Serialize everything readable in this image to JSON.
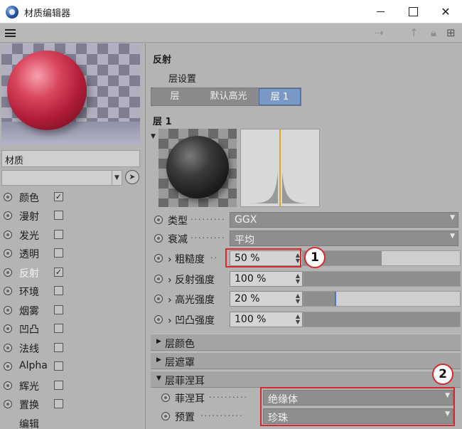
{
  "window": {
    "title": "材质编辑器"
  },
  "sidebar": {
    "material_name": "材质",
    "channels": [
      {
        "label": "颜色",
        "checkbox": true,
        "checked": true,
        "active": false
      },
      {
        "label": "漫射",
        "checkbox": true,
        "checked": false,
        "active": false
      },
      {
        "label": "发光",
        "checkbox": true,
        "checked": false,
        "active": false
      },
      {
        "label": "透明",
        "checkbox": true,
        "checked": false,
        "active": false
      },
      {
        "label": "反射",
        "checkbox": true,
        "checked": true,
        "active": true
      },
      {
        "label": "环境",
        "checkbox": true,
        "checked": false,
        "active": false
      },
      {
        "label": "烟雾",
        "checkbox": true,
        "checked": false,
        "active": false
      },
      {
        "label": "凹凸",
        "checkbox": true,
        "checked": false,
        "active": false
      },
      {
        "label": "法线",
        "checkbox": true,
        "checked": false,
        "active": false
      },
      {
        "label": "Alpha",
        "checkbox": true,
        "checked": false,
        "active": false
      },
      {
        "label": "辉光",
        "checkbox": true,
        "checked": false,
        "active": false
      },
      {
        "label": "置换",
        "checkbox": true,
        "checked": false,
        "active": false
      },
      {
        "label": "编辑",
        "checkbox": false,
        "checked": false,
        "active": false
      }
    ]
  },
  "main": {
    "section_title": "反射",
    "layer_settings_label": "层设置",
    "tabs": [
      {
        "label": "层",
        "selected": false
      },
      {
        "label": "默认高光",
        "selected": false
      },
      {
        "label": "层 1",
        "selected": true
      }
    ],
    "layer_title": "层 1",
    "type": {
      "label": "类型",
      "value": "GGX"
    },
    "attenuation": {
      "label": "衰减",
      "value": "平均"
    },
    "roughness": {
      "label": "粗糙度",
      "value": "50 %",
      "level": 0.5
    },
    "reflect_strength": {
      "label": "反射强度",
      "value": "100 %",
      "level": 1.0
    },
    "specular_strength": {
      "label": "高光强度",
      "value": "20 %",
      "level": 0.2
    },
    "bump_strength": {
      "label": "凹凸强度",
      "value": "100 %",
      "level": 1.0
    },
    "groups": {
      "layer_color": "层颜色",
      "layer_mask": "层遮罩",
      "layer_fresnel": "层菲涅耳"
    },
    "fresnel": {
      "label": "菲涅耳",
      "value": "绝缘体"
    },
    "preset": {
      "label": "预置",
      "value": "珍珠"
    }
  },
  "annotations": {
    "badge1": "1",
    "badge2": "2"
  },
  "colors": {
    "highlight": "#d42a2a",
    "tab_selected": "#7a98c6",
    "accent_mark": "#4a78c8"
  }
}
